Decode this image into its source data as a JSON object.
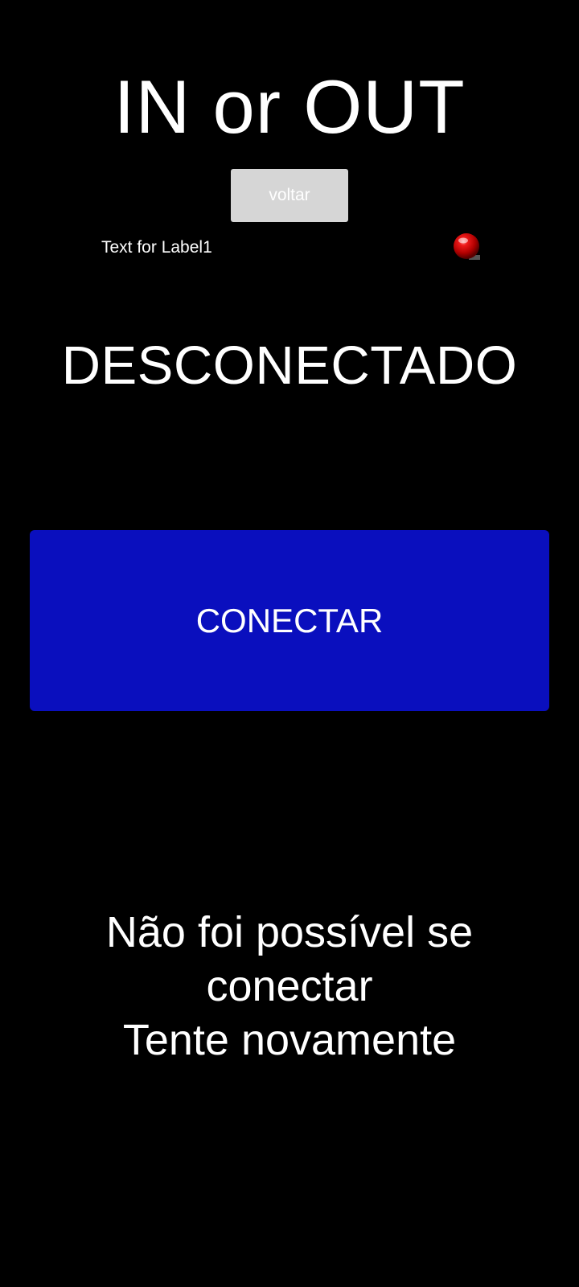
{
  "app": {
    "title": "IN or OUT"
  },
  "toolbar": {
    "back_label": "voltar"
  },
  "label1": {
    "text": "Text for Label1"
  },
  "status": {
    "indicator_icon": "red-led-icon",
    "indicator_color": "#cc0000",
    "text": "DESCONECTADO"
  },
  "connect_button": {
    "label": "CONECTAR",
    "color": "#0a0fbe"
  },
  "message": {
    "lines": [
      "Não foi possível se",
      "conectar",
      "Tente novamente"
    ]
  }
}
